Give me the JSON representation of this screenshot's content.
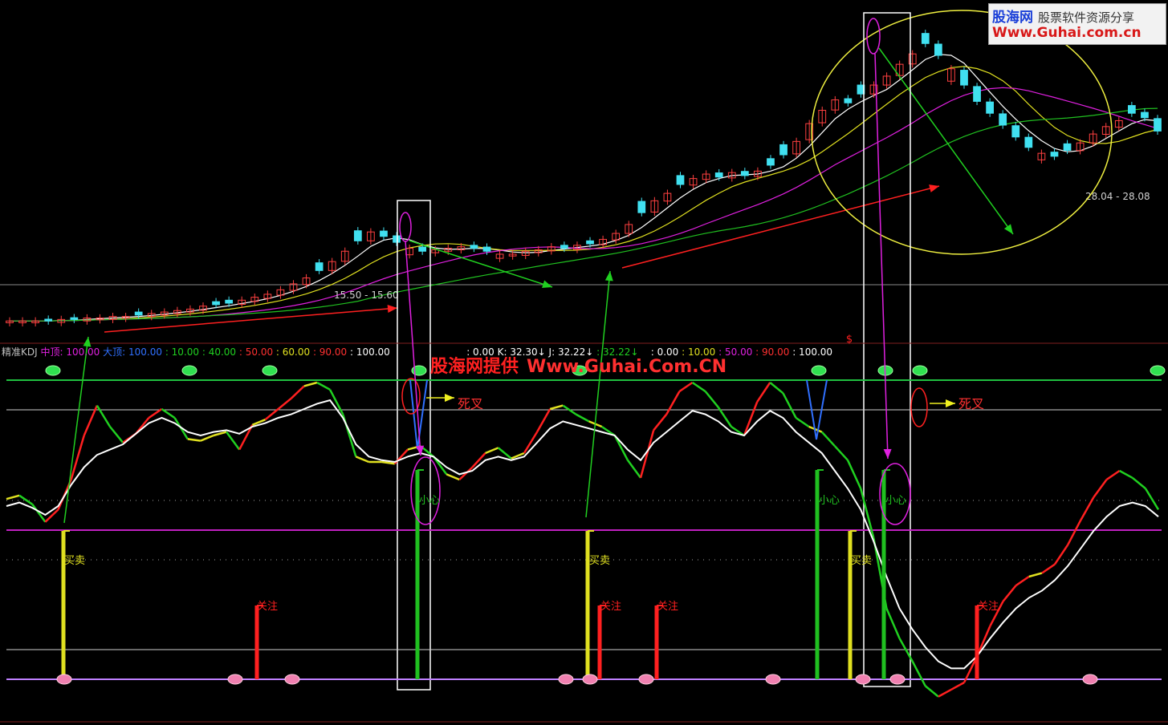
{
  "watermark": {
    "site_name": "股海网",
    "tagline": "股票软件资源分享",
    "url": "Www.Guhai.com.cn"
  },
  "center_watermark": {
    "text": "股海网提供",
    "url": "Www.Guhai.Com.CN"
  },
  "price_labels": {
    "range_left": "15.50 - 15.60",
    "range_right": "28.04 - 28.08"
  },
  "indicator_header": [
    {
      "text": "精准KDJ ",
      "color": "#c0c0c0"
    },
    {
      "text": "中顶: 100.00 ",
      "color": "#e020e0"
    },
    {
      "text": "大顶: 100.00 ",
      "color": "#3070ff"
    },
    {
      "text": ": 10.00 ",
      "color": "#20d020"
    },
    {
      "text": ": 40.00 ",
      "color": "#20d020"
    },
    {
      "text": ": 50.00 ",
      "color": "#ff3030"
    },
    {
      "text": ": 60.00 ",
      "color": "#e0e020"
    },
    {
      "text": ": 90.00 ",
      "color": "#ff3030"
    },
    {
      "text": ": 100.00",
      "color": "#ffffff"
    },
    {
      "text": "                         : 0.00 ",
      "color": "#ffffff"
    },
    {
      "text": "K: 32.30↓ ",
      "color": "#ffffff"
    },
    {
      "text": "J: 32.22↓ ",
      "color": "#ffffff"
    },
    {
      "text": ": 32.22↓ ",
      "color": "#20d020"
    },
    {
      "text": "   : 0.00 ",
      "color": "#ffffff"
    },
    {
      "text": ": 10.00 ",
      "color": "#e0e020"
    },
    {
      "text": ": 50.00 ",
      "color": "#e020e0"
    },
    {
      "text": ": 90.00 ",
      "color": "#ff3030"
    },
    {
      "text": ": 100.00",
      "color": "#ffffff"
    }
  ],
  "annotations": {
    "death_cross_1": "死叉",
    "death_cross_2": "死叉",
    "careful_1": "小心",
    "careful_2": "小心",
    "careful_3": "小心",
    "buy_sell_1": "买卖",
    "buy_sell_2": "买卖",
    "buy_sell_3": "买卖",
    "attention_1": "关注",
    "attention_2": "关注",
    "attention_3": "关注",
    "attention_4": "关注",
    "dollar_mark": "$"
  },
  "chart_data": [
    {
      "type": "candlestick",
      "title": "",
      "series": [
        {
          "name": "price",
          "values": [
            15.3,
            15.3,
            15.3,
            15.3,
            15.4,
            15.4,
            15.5,
            15.5,
            15.6,
            15.6,
            15.7,
            15.8,
            15.9,
            16.0,
            16.1,
            16.3,
            16.4,
            16.5,
            16.7,
            16.9,
            17.1,
            17.4,
            17.8,
            18.2,
            18.7,
            19.3,
            20.0,
            20.7,
            21.3,
            21.0,
            20.6,
            20.2,
            20.0,
            20.1,
            20.2,
            20.3,
            20.2,
            20.0,
            19.8,
            19.8,
            20.0,
            20.1,
            20.3,
            20.2,
            20.4,
            20.5,
            20.8,
            21.2,
            21.8,
            22.6,
            23.4,
            23.9,
            24.5,
            24.9,
            25.2,
            25.0,
            25.3,
            25.1,
            25.4,
            25.8,
            26.5,
            27.4,
            28.6,
            29.5,
            30.2,
            30.0,
            30.6,
            31.2,
            31.8,
            32.6,
            33.3,
            34.0,
            33.2,
            32.3,
            31.2,
            30.1,
            29.3,
            28.5,
            27.7,
            27.0,
            26.6,
            26.4,
            26.8,
            27.3,
            27.9,
            28.4,
            28.8,
            29.3,
            29.0,
            28.1
          ]
        }
      ],
      "moving_averages": [
        "white",
        "yellow",
        "magenta",
        "green"
      ],
      "y_range": [
        14.5,
        36.5
      ]
    },
    {
      "type": "line",
      "title": "精准KDJ",
      "series": [
        {
          "name": "K",
          "values": [
            34,
            36,
            31,
            21,
            28,
            45,
            70,
            87,
            75,
            66,
            71,
            80,
            85,
            80,
            68,
            67,
            70,
            72,
            62,
            76,
            79,
            85,
            91,
            98,
            100,
            96,
            82,
            58,
            55,
            55,
            54,
            62,
            64,
            58,
            48,
            45,
            52,
            60,
            63,
            57,
            60,
            72,
            85,
            87,
            82,
            78,
            75,
            70,
            56,
            46,
            73,
            82,
            95,
            100,
            95,
            86,
            75,
            70,
            89,
            100,
            94,
            80,
            75,
            72,
            64,
            56,
            40,
            12,
            -28,
            -45,
            -58,
            -72,
            -78,
            -74,
            -70,
            -55,
            -38,
            -24,
            -15,
            -10,
            -8,
            -3,
            8,
            22,
            35,
            45,
            50,
            46,
            40,
            28
          ]
        },
        {
          "name": "D",
          "values": [
            30,
            32,
            29,
            25,
            30,
            42,
            52,
            59,
            62,
            65,
            71,
            77,
            80,
            77,
            72,
            70,
            72,
            73,
            71,
            75,
            77,
            80,
            82,
            85,
            88,
            90,
            80,
            65,
            58,
            56,
            55,
            58,
            60,
            58,
            52,
            48,
            50,
            56,
            58,
            56,
            58,
            66,
            74,
            78,
            76,
            74,
            72,
            70,
            62,
            56,
            66,
            72,
            78,
            84,
            82,
            78,
            72,
            70,
            78,
            84,
            80,
            72,
            66,
            60,
            50,
            40,
            28,
            10,
            -10,
            -28,
            -40,
            -50,
            -58,
            -62,
            -62,
            -55,
            -45,
            -36,
            -28,
            -22,
            -18,
            -12,
            -4,
            6,
            16,
            24,
            30,
            32,
            30,
            24
          ]
        }
      ],
      "y_range": [
        -90,
        110
      ]
    }
  ]
}
